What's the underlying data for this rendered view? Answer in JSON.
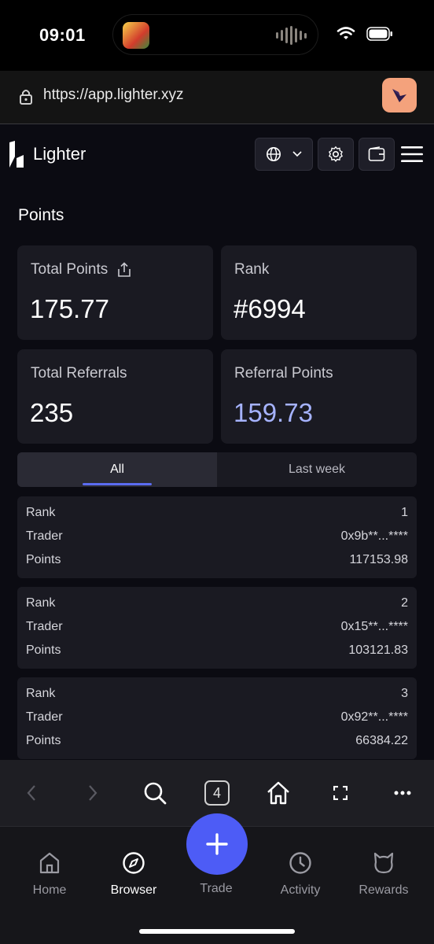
{
  "status": {
    "time": "09:01"
  },
  "browser": {
    "url": "https://app.lighter.xyz"
  },
  "header": {
    "brand": "Lighter"
  },
  "page": {
    "title": "Points"
  },
  "stats": {
    "total_points": {
      "label": "Total Points",
      "value": "175.77"
    },
    "rank": {
      "label": "Rank",
      "value": "#6994"
    },
    "total_referrals": {
      "label": "Total Referrals",
      "value": "235"
    },
    "referral_points": {
      "label": "Referral Points",
      "value": "159.73"
    }
  },
  "tabs": [
    {
      "label": "All",
      "active": true
    },
    {
      "label": "Last week",
      "active": false
    }
  ],
  "leaderboard": {
    "labels": {
      "rank": "Rank",
      "trader": "Trader",
      "points": "Points"
    },
    "rows": [
      {
        "rank": "1",
        "trader": "0x9b**...****",
        "points": "117153.98"
      },
      {
        "rank": "2",
        "trader": "0x15**...****",
        "points": "103121.83"
      },
      {
        "rank": "3",
        "trader": "0x92**...****",
        "points": "66384.22"
      }
    ]
  },
  "toolbar": {
    "tab_count": "4"
  },
  "bottom_nav": {
    "home": "Home",
    "browser": "Browser",
    "trade": "Trade",
    "activity": "Activity",
    "rewards": "Rewards"
  },
  "colors": {
    "accent": "#4d5cf6",
    "referral_value": "#a6b3ff",
    "ext_badge": "#f4a27c"
  }
}
